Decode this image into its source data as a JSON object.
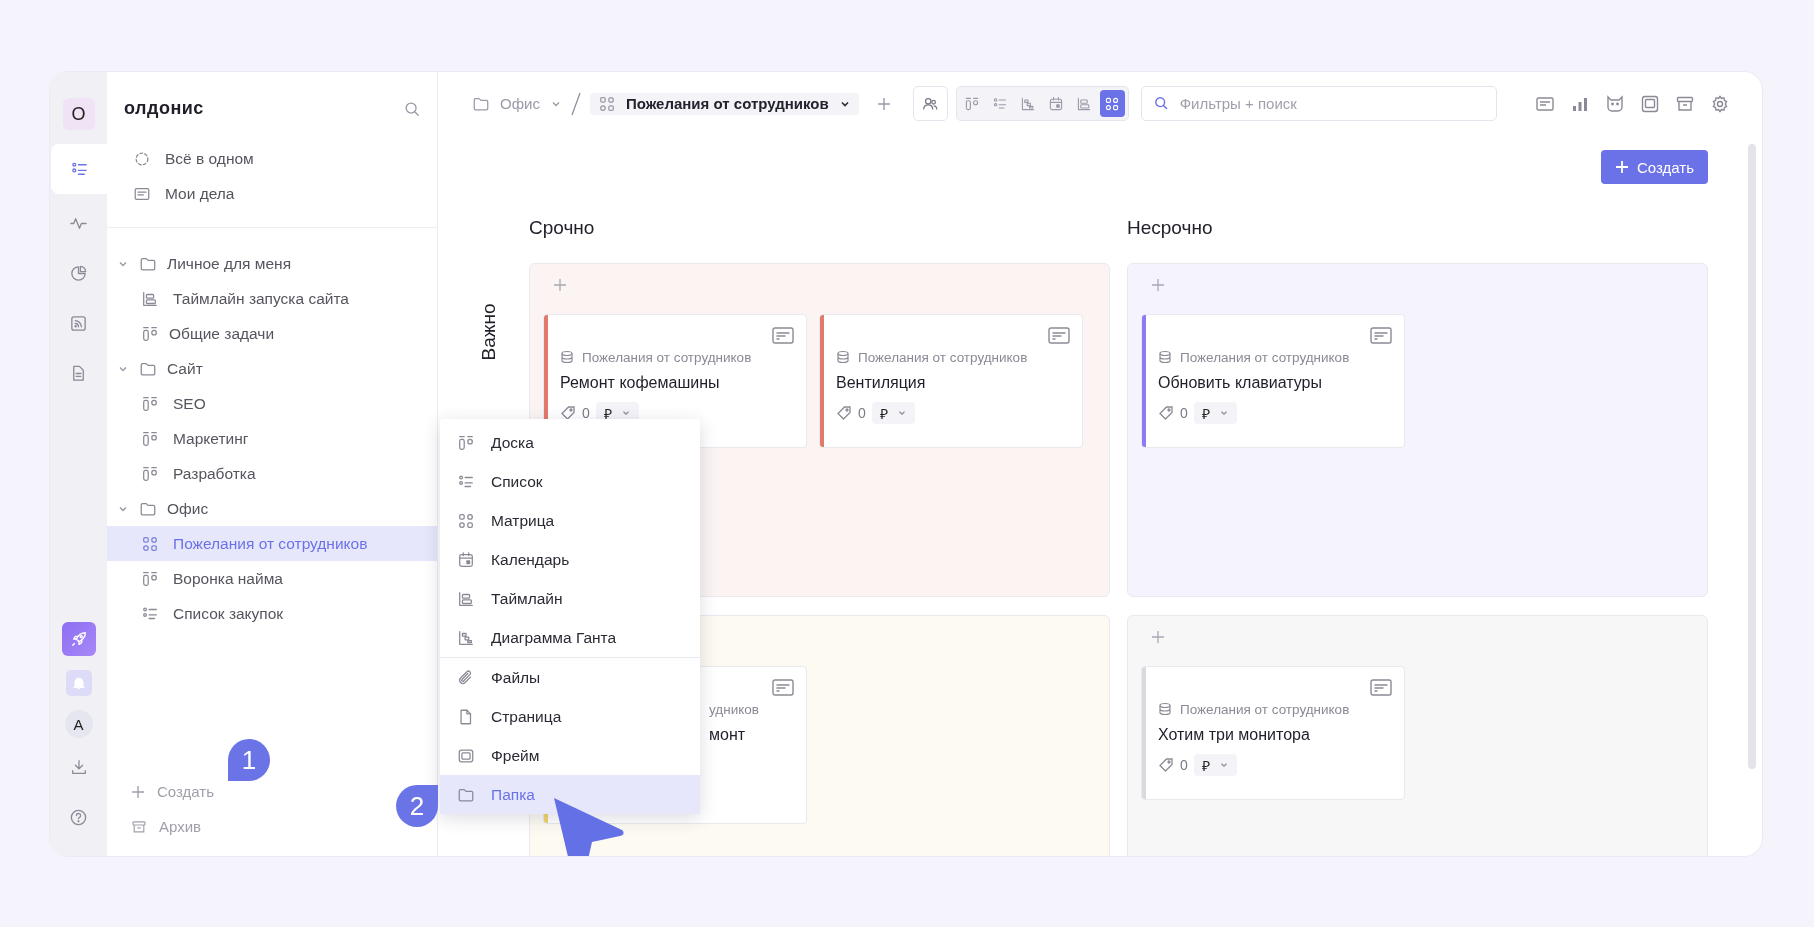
{
  "rail": {
    "workspace_avatar": "О",
    "user_avatar": "A",
    "items": [
      {
        "kind": "list",
        "selected": true
      },
      {
        "kind": "activity",
        "selected": false
      },
      {
        "kind": "chart",
        "selected": false
      },
      {
        "kind": "feed",
        "selected": false
      },
      {
        "kind": "doc",
        "selected": false
      }
    ]
  },
  "sidebar": {
    "title": "олдонис",
    "top_items": [
      {
        "kind": "all",
        "label": "Всё в одном"
      },
      {
        "kind": "mine",
        "label": "Мои дела"
      }
    ],
    "tree": [
      {
        "kind": "folder",
        "label": "Личное для меня",
        "expanded": true,
        "selected": false,
        "children": [
          {
            "kind": "timeline",
            "label": "Таймлайн запуска сайта",
            "selected": false
          }
        ]
      },
      {
        "kind": "board",
        "label": "Общие задачи",
        "selected": false
      },
      {
        "kind": "folder",
        "label": "Сайт",
        "expanded": true,
        "selected": false,
        "children": [
          {
            "kind": "board",
            "label": "SEO",
            "selected": false
          },
          {
            "kind": "board",
            "label": "Маркетинг",
            "selected": false
          },
          {
            "kind": "board",
            "label": "Разработка",
            "selected": false
          }
        ]
      },
      {
        "kind": "folder",
        "label": "Офис",
        "expanded": true,
        "selected": false,
        "children": [
          {
            "kind": "matrix",
            "label": "Пожелания от сотрудников",
            "selected": true
          },
          {
            "kind": "board",
            "label": "Воронка найма",
            "selected": false
          },
          {
            "kind": "list",
            "label": "Список закупок",
            "selected": false
          }
        ]
      }
    ],
    "create_label": "Создать",
    "archive_label": "Архив"
  },
  "toolbar": {
    "breadcrumb_folder": "Офис",
    "breadcrumb_current": "Пожелания от сотрудников",
    "views": [
      {
        "kind": "board",
        "selected": false
      },
      {
        "kind": "list",
        "selected": false
      },
      {
        "kind": "gantt",
        "selected": false
      },
      {
        "kind": "calendar",
        "selected": false
      },
      {
        "kind": "timeline",
        "selected": false
      },
      {
        "kind": "matrix",
        "selected": true
      }
    ],
    "search": {
      "placeholder": "Фильтры + поиск"
    },
    "create_button": "Создать"
  },
  "matrix": {
    "columns": [
      "Срочно",
      "Несрочно"
    ],
    "rows": [
      "Важно"
    ],
    "quadrants": [
      {
        "color": "#fbf4f3",
        "cards": [
          {
            "kind": "full",
            "color": "#e07a6a",
            "source": "Пожелания от сотрудников",
            "title": "Ремонт кофемашины",
            "count": "0",
            "currency": "₽"
          },
          {
            "kind": "full",
            "color": "#e07a6a",
            "source": "Пожелания от сотрудников",
            "title": "Вентиляция",
            "count": "0",
            "currency": "₽"
          }
        ]
      },
      {
        "color": "#f5f4fe",
        "cards": [
          {
            "kind": "full",
            "color": "#8b7cf6",
            "source": "Пожелания от сотрудников",
            "title": "Обновить клавиатуры",
            "count": "0",
            "currency": "₽"
          }
        ]
      },
      {
        "color": "#fdfaf2",
        "cards": [
          {
            "kind": "covered",
            "color": "#f2d46a",
            "source": "удников",
            "title": "монт"
          }
        ]
      },
      {
        "color": "#f7f7f8",
        "cards": [
          {
            "kind": "full",
            "color": "#d9d9de",
            "source": "Пожелания от сотрудников",
            "title": "Хотим три монитора",
            "count": "0",
            "currency": "₽"
          }
        ]
      }
    ]
  },
  "create_menu": {
    "sections": [
      [
        {
          "kind": "board",
          "label": "Доска",
          "selected": false
        },
        {
          "kind": "list",
          "label": "Список",
          "selected": false
        },
        {
          "kind": "matrix",
          "label": "Матрица",
          "selected": false
        },
        {
          "kind": "calendar",
          "label": "Календарь",
          "selected": false
        },
        {
          "kind": "timeline",
          "label": "Таймлайн",
          "selected": false
        },
        {
          "kind": "gantt",
          "label": "Диаграмма Ганта",
          "selected": false
        }
      ],
      [
        {
          "kind": "files",
          "label": "Файлы",
          "selected": false
        },
        {
          "kind": "page",
          "label": "Страница",
          "selected": false
        },
        {
          "kind": "frame",
          "label": "Фрейм",
          "selected": false
        },
        {
          "kind": "folder",
          "label": "Папка",
          "selected": true
        }
      ]
    ]
  },
  "annotations": [
    "1",
    "2"
  ]
}
